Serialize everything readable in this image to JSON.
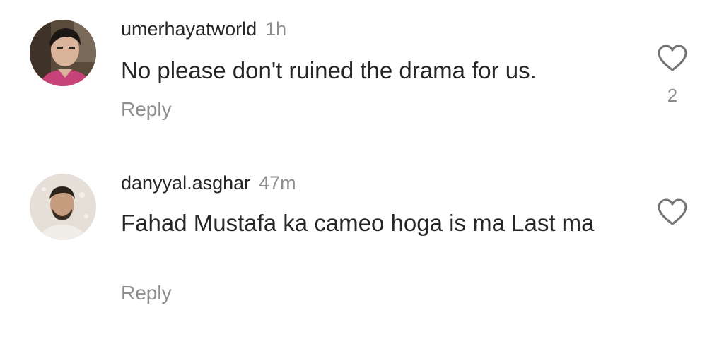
{
  "comments": [
    {
      "username": "umerhayatworld",
      "time": "1h",
      "text": "No please don't ruined the drama for us.",
      "reply_label": "Reply",
      "like_count": "2",
      "icons": {
        "like": "heart-outline-icon",
        "avatar": "user-avatar"
      }
    },
    {
      "username": "danyyal.asghar",
      "time": "47m",
      "text": "Fahad Mustafa ka cameo hoga is ma Last ma",
      "reply_label": "Reply",
      "icons": {
        "like": "heart-outline-icon",
        "avatar": "user-avatar"
      }
    }
  ],
  "colors": {
    "primary_text": "#262626",
    "secondary_text": "#8e8e8e",
    "background": "#ffffff"
  }
}
